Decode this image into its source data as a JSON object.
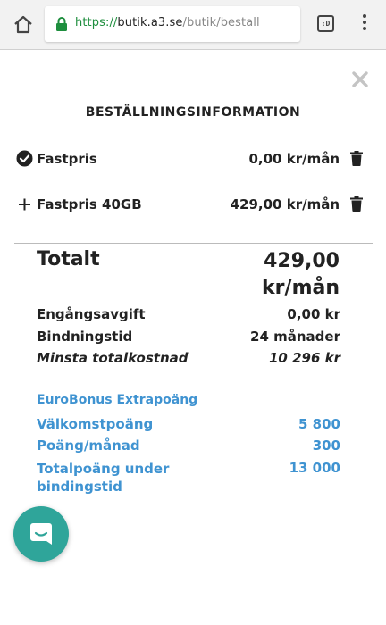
{
  "browser": {
    "url_scheme": "https://",
    "url_host": "butik.a3.se",
    "url_path": "/butik/bestall",
    "tabs_label": ":D"
  },
  "order": {
    "title": "BESTÄLLNINGSINFORMATION",
    "items": [
      {
        "name": "Fastpris",
        "price": "0,00 kr/mån",
        "icon": "check-circle-icon"
      },
      {
        "name": "Fastpris 40GB",
        "price": "429,00 kr/mån",
        "icon": "plus-icon"
      }
    ],
    "total_label": "Totalt",
    "total_value_line1": "429,00",
    "total_value_line2": "kr/mån",
    "rows": [
      {
        "label": "Engångsavgift",
        "value": "0,00 kr"
      },
      {
        "label": "Bindningstid",
        "value": "24 månader"
      },
      {
        "label": "Minsta totalkostnad",
        "value": "10 296 kr"
      }
    ]
  },
  "bonus": {
    "title": "EuroBonus Extrapoäng",
    "rows": [
      {
        "label": "Välkomstpoäng",
        "value": "5 800"
      },
      {
        "label": "Poäng/månad",
        "value": "300"
      },
      {
        "label_line1": "Totalpoäng under",
        "label_line2": "bindingstid",
        "value": "13 000"
      }
    ]
  },
  "colors": {
    "accent_blue": "#3f93d1",
    "chat_teal": "#2fa59a",
    "secure_green": "#1e8e3e"
  }
}
